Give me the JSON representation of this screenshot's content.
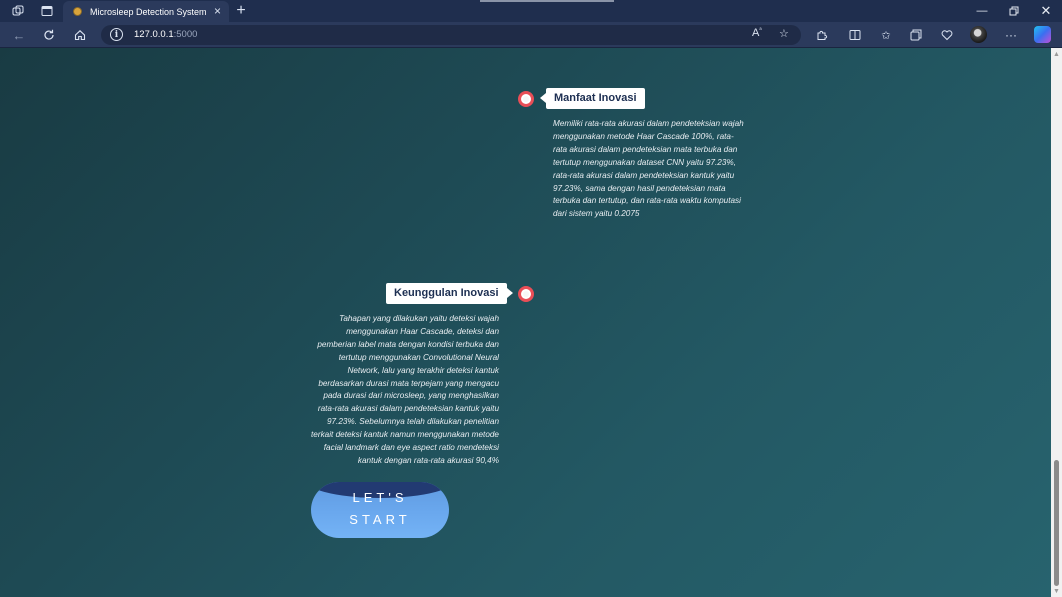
{
  "browser": {
    "tab_title": "Microsleep Detection System",
    "url_host": "127.0.0.1",
    "url_port": ":5000"
  },
  "icons": [
    "workspaces-icon",
    "tab-actions-icon",
    "back-icon",
    "refresh-icon",
    "home-icon",
    "site-info-icon",
    "read-aloud-icon",
    "favorite-icon",
    "extensions-icon",
    "split-screen-icon",
    "favorites-icon",
    "collections-icon",
    "performance-icon",
    "settings-more-icon",
    "copilot-icon"
  ],
  "timeline": [
    {
      "title": "Manfaat Inovasi",
      "lines": [
        "Memiliki rata-rata akurasi dalam pendeteksian wajah",
        "menggunakan metode Haar Cascade 100%, rata-",
        "rata akurasi dalam pendeteksian mata terbuka dan",
        "tertutup menggunakan dataset CNN yaitu 97.23%,",
        "rata-rata akurasi dalam pendeteksian kantuk yaitu",
        "97.23%, sama dengan hasil pendeteksian mata",
        "terbuka dan tertutup, dan rata-rata waktu komputasi",
        "dari sistem yaitu 0.2075"
      ]
    },
    {
      "title": "Keunggulan Inovasi",
      "lines": [
        "Tahapan yang dilakukan yaitu deteksi wajah",
        "menggunakan Haar Cascade, deteksi dan",
        "pemberian label mata dengan kondisi terbuka dan",
        "tertutup menggunakan Convolutional Neural",
        "Network, lalu yang terakhir deteksi kantuk",
        "berdasarkan durasi mata terpejam yang mengacu",
        "pada durasi dari microsleep, yang menghasilkan",
        "rata-rata akurasi dalam pendeteksian kantuk yaitu",
        "97.23%. Sebelumnya telah dilakukan penelitian",
        "terkait deteksi kantuk namun menggunakan metode",
        "facial landmark dan eye aspect ratio mendeteksi",
        "kantuk dengan rata-rata akurasi 90,4%"
      ]
    }
  ],
  "start_button": {
    "line1": "LET'S",
    "line2": "START"
  },
  "colors": {
    "accent_dot": "#e94e57",
    "title_text": "#1d2f52",
    "button": "#6aa8ee"
  }
}
